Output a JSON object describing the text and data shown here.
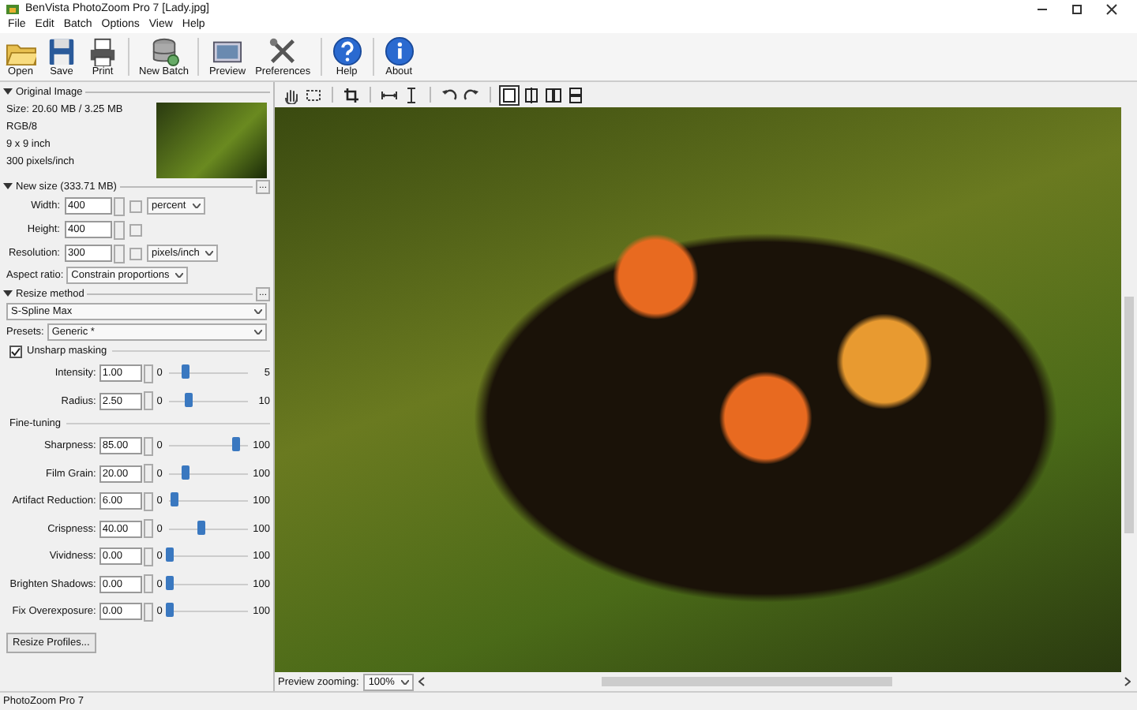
{
  "window": {
    "title": "BenVista PhotoZoom Pro 7 [Lady.jpg]"
  },
  "menu": [
    "File",
    "Edit",
    "Batch",
    "Options",
    "View",
    "Help"
  ],
  "toolbar": [
    [
      {
        "label": "Open",
        "kind": "open"
      },
      {
        "label": "Save",
        "kind": "save"
      },
      {
        "label": "Print",
        "kind": "print"
      }
    ],
    [
      {
        "label": "New Batch",
        "kind": "batch"
      }
    ],
    [
      {
        "label": "Preview",
        "kind": "preview"
      },
      {
        "label": "Preferences",
        "kind": "preferences"
      }
    ],
    [
      {
        "label": "Help",
        "kind": "help"
      }
    ],
    [
      {
        "label": "About",
        "kind": "about"
      }
    ]
  ],
  "original_image": {
    "title": "Original Image",
    "expanded": true,
    "info": [
      "Size: 20.60 MB / 3.25 MB",
      "RGB/8",
      "9 x 9 inch",
      "300 pixels/inch"
    ]
  },
  "new_size": {
    "title": "New size (333.71 MB)",
    "expanded": true,
    "more_button": "...",
    "fields": [
      {
        "label": "Width:",
        "value": "400",
        "unit": "percent"
      },
      {
        "label": "Height:",
        "value": "400"
      },
      {
        "label": "Resolution:",
        "value": "300",
        "unit": "pixels/inch"
      }
    ],
    "aspect_label": "Aspect ratio:",
    "aspect_value": "Constrain proportions"
  },
  "resize_method": {
    "title": "Resize method",
    "expanded": true,
    "more_button": "...",
    "method": "S-Spline Max",
    "presets_label": "Presets:",
    "preset": "Generic *"
  },
  "unsharp": {
    "label": "Unsharp masking",
    "checked": true,
    "sliders": [
      {
        "label": "Intensity:",
        "value": "1.00",
        "min": "0",
        "max": "5",
        "level": 0.2
      },
      {
        "label": "Radius:",
        "value": "2.50",
        "min": "0",
        "max": "10",
        "level": 0.25
      }
    ]
  },
  "fine_tuning": {
    "title": "Fine-tuning",
    "sliders": [
      {
        "label": "Sharpness:",
        "value": "85.00",
        "min": "0",
        "max": "100",
        "level": 0.85
      },
      {
        "label": "Film Grain:",
        "value": "20.00",
        "min": "0",
        "max": "100",
        "level": 0.2
      },
      {
        "label": "Artifact Reduction:",
        "value": "6.00",
        "min": "0",
        "max": "100",
        "level": 0.06
      },
      {
        "label": "Crispness:",
        "value": "40.00",
        "min": "0",
        "max": "100",
        "level": 0.4
      },
      {
        "label": "Vividness:",
        "value": "0.00",
        "min": "0",
        "max": "100",
        "level": 0
      },
      {
        "label": "Brighten Shadows:",
        "value": "0.00",
        "min": "0",
        "max": "100",
        "level": 0
      },
      {
        "label": "Fix Overexposure:",
        "value": "0.00",
        "min": "0",
        "max": "100",
        "level": 0
      }
    ]
  },
  "resize_profiles_button": "Resize Profiles...",
  "preview": {
    "tools": [
      {
        "kind": "hand"
      },
      {
        "kind": "select"
      },
      {
        "kind": "crop"
      },
      {
        "kind": "fit-width"
      },
      {
        "kind": "fit-height"
      },
      {
        "kind": "rotate-left"
      },
      {
        "kind": "rotate-right"
      }
    ],
    "view_modes": [
      {
        "kind": "single",
        "selected": true
      },
      {
        "kind": "split-vertical",
        "selected": false
      },
      {
        "kind": "side-by-side",
        "selected": false
      },
      {
        "kind": "split-horizontal",
        "selected": false
      }
    ],
    "zoom_label": "Preview zooming:",
    "zoom_value": "100%"
  },
  "status_bar": "PhotoZoom Pro 7"
}
